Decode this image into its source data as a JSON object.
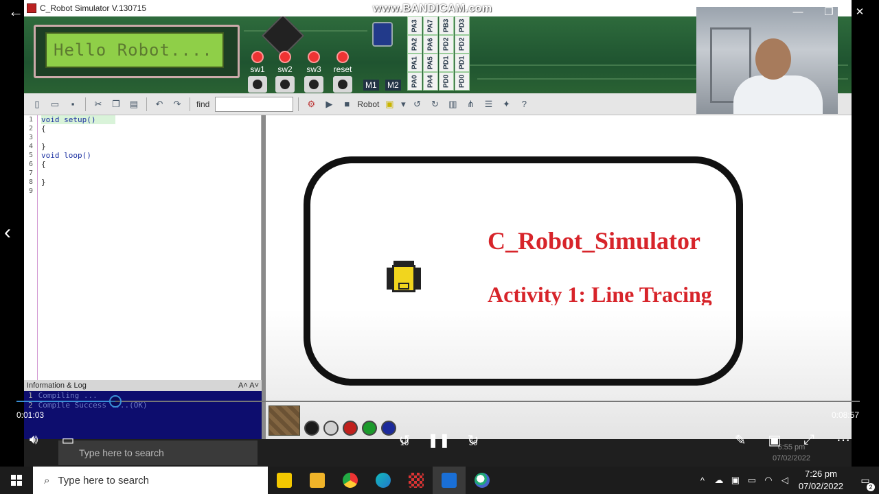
{
  "app": {
    "title": "C_Robot Simulator V.130715"
  },
  "watermark": "www.BANDICAM.com",
  "board": {
    "lcd_text": "Hello Robot....",
    "switches": [
      "sw1",
      "sw2",
      "sw3",
      "reset"
    ],
    "motors": [
      "M1",
      "M2"
    ],
    "ports": [
      "PA3",
      "PA7",
      "PB3",
      "PD3",
      "PA2",
      "PA6",
      "PD2",
      "PD2",
      "PA1",
      "PA5",
      "PD1",
      "PD1",
      "PA0",
      "PA4",
      "PD0",
      "PD0"
    ]
  },
  "toolbar": {
    "find_label": "find",
    "robot_label": "Robot"
  },
  "editor": {
    "line_numbers": [
      "1",
      "2",
      "3",
      "4",
      "5",
      "6",
      "7",
      "8",
      "9"
    ],
    "lines": [
      "void setup()",
      "{",
      "",
      "}",
      "void loop()",
      "{",
      "",
      "}",
      ""
    ]
  },
  "log": {
    "header": "Information & Log",
    "font_controls": "A˄ A˅",
    "lines": [
      {
        "n": "1",
        "text": "Compiling ..."
      },
      {
        "n": "2",
        "text": "Compile Success ....(OK)"
      }
    ]
  },
  "stage": {
    "title": "C_Robot_Simulator",
    "subtitle": "Activity 1: Line Tracing"
  },
  "palette_colors": [
    "#1a1a1a",
    "#d0d0d0",
    "#c0201c",
    "#1c9a2c",
    "#1c2a9a"
  ],
  "player": {
    "current_time": "0:01:03",
    "total_time": "0:08:57",
    "progress": 0.1173,
    "skip_back": "10",
    "skip_forward": "30"
  },
  "inner_taskbar": {
    "search_placeholder": "Type here to search",
    "time": "6:55 pm",
    "date": "07/02/2022"
  },
  "taskbar": {
    "search_placeholder": "Type here to search",
    "time": "7:26 pm",
    "date": "07/02/2022",
    "notifications": "2"
  }
}
